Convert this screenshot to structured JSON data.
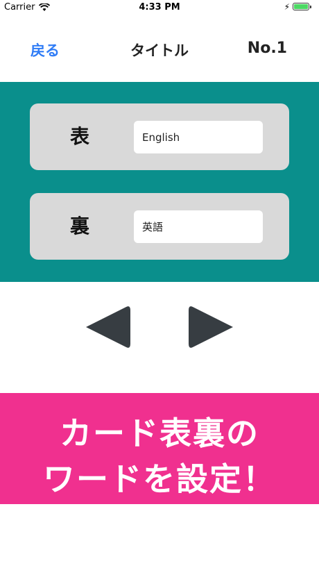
{
  "status_bar": {
    "carrier": "Carrier",
    "time": "4:33 PM",
    "battery_level": 1.0,
    "battery_color": "#4cd964"
  },
  "nav": {
    "back_label": "戻る",
    "title": "タイトル",
    "number": "No.1"
  },
  "editor": {
    "background_color": "#0a8f8c",
    "front": {
      "label": "表",
      "value": "English"
    },
    "back": {
      "label": "裏",
      "value": "英語"
    }
  },
  "controls": {
    "prev_icon": "triangle-left-icon",
    "next_icon": "triangle-right-icon",
    "color": "#373d42"
  },
  "promo": {
    "background_color": "#f0308f",
    "line1": "カード表裏の",
    "line2": "ワードを設定！"
  }
}
